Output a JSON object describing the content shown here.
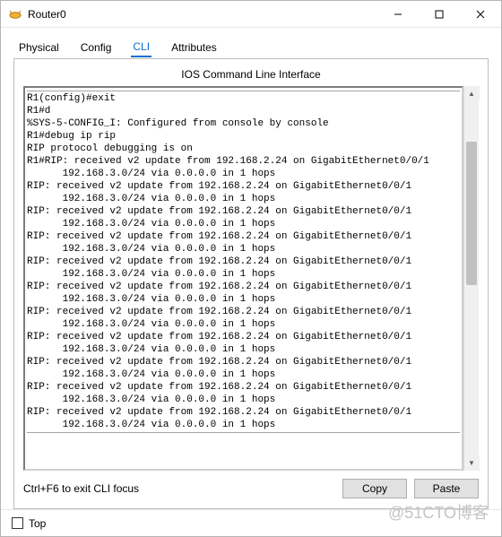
{
  "window": {
    "title": "Router0"
  },
  "tabs": {
    "physical": "Physical",
    "config": "Config",
    "cli": "CLI",
    "attributes": "Attributes"
  },
  "panel": {
    "title": "IOS Command Line Interface",
    "hint": "Ctrl+F6 to exit CLI focus",
    "copy": "Copy",
    "paste": "Paste",
    "top": "Top"
  },
  "terminal": {
    "lines": [
      "R1(config)#exit",
      "R1#d",
      "%SYS-5-CONFIG_I: Configured from console by console",
      "R1#debug ip rip",
      "RIP protocol debugging is on",
      "R1#RIP: received v2 update from 192.168.2.24 on GigabitEthernet0/0/1",
      "      192.168.3.0/24 via 0.0.0.0 in 1 hops",
      "RIP: received v2 update from 192.168.2.24 on GigabitEthernet0/0/1",
      "      192.168.3.0/24 via 0.0.0.0 in 1 hops",
      "RIP: received v2 update from 192.168.2.24 on GigabitEthernet0/0/1",
      "      192.168.3.0/24 via 0.0.0.0 in 1 hops",
      "RIP: received v2 update from 192.168.2.24 on GigabitEthernet0/0/1",
      "      192.168.3.0/24 via 0.0.0.0 in 1 hops",
      "RIP: received v2 update from 192.168.2.24 on GigabitEthernet0/0/1",
      "      192.168.3.0/24 via 0.0.0.0 in 1 hops",
      "RIP: received v2 update from 192.168.2.24 on GigabitEthernet0/0/1",
      "      192.168.3.0/24 via 0.0.0.0 in 1 hops",
      "RIP: received v2 update from 192.168.2.24 on GigabitEthernet0/0/1",
      "      192.168.3.0/24 via 0.0.0.0 in 1 hops",
      "RIP: received v2 update from 192.168.2.24 on GigabitEthernet0/0/1",
      "      192.168.3.0/24 via 0.0.0.0 in 1 hops",
      "RIP: received v2 update from 192.168.2.24 on GigabitEthernet0/0/1",
      "      192.168.3.0/24 via 0.0.0.0 in 1 hops",
      "RIP: received v2 update from 192.168.2.24 on GigabitEthernet0/0/1",
      "      192.168.3.0/24 via 0.0.0.0 in 1 hops",
      "RIP: received v2 update from 192.168.2.24 on GigabitEthernet0/0/1",
      "      192.168.3.0/24 via 0.0.0.0 in 1 hops"
    ]
  },
  "watermark": "@51CTO博客"
}
